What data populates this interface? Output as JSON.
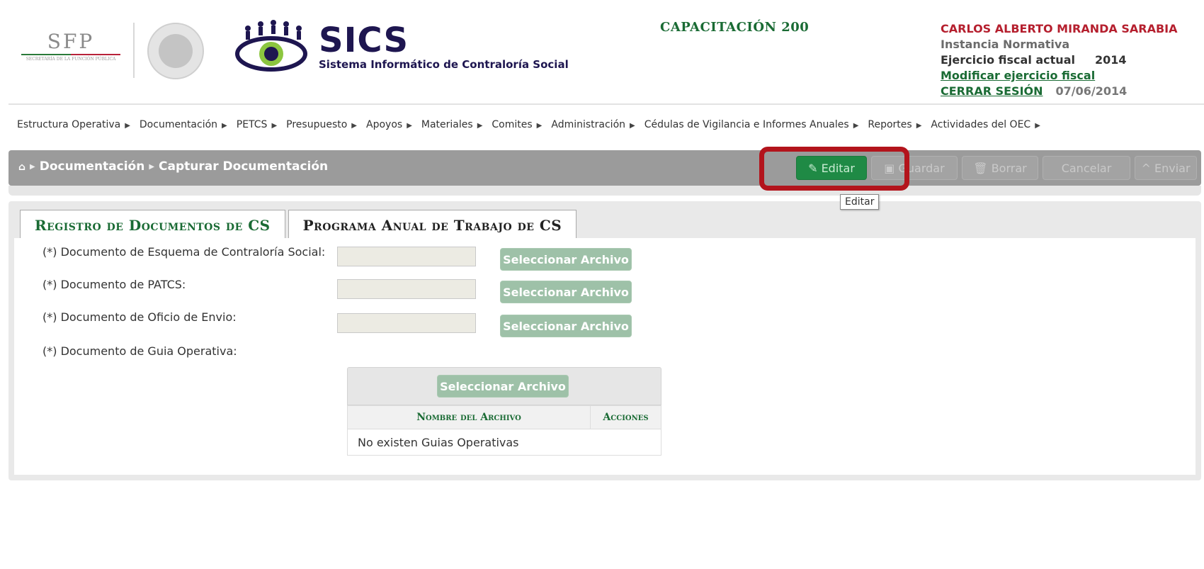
{
  "header": {
    "sfp_logo": {
      "text": "SFP",
      "subtitle": "SECRETARÍA DE LA FUNCIÓN PÚBLICA"
    },
    "app_logo": {
      "title": "SICS",
      "subtitle": "Sistema Informático de Contraloría Social"
    },
    "environment": "CAPACITACIÓN 200",
    "user": {
      "name": "CARLOS ALBERTO MIRANDA SARABIA",
      "role": "Instancia Normativa",
      "fiscal_label": "Ejercicio fiscal actual",
      "fiscal_year": "2014",
      "modify_link": "Modificar ejercicio fiscal",
      "logout_link": "CERRAR SESIÓN",
      "date": "07/06/2014"
    }
  },
  "menu": [
    {
      "label": "Estructura Operativa"
    },
    {
      "label": "Documentación"
    },
    {
      "label": "PETCS"
    },
    {
      "label": "Presupuesto"
    },
    {
      "label": "Apoyos"
    },
    {
      "label": "Materiales"
    },
    {
      "label": "Comites"
    },
    {
      "label": "Administración"
    },
    {
      "label": "Cédulas de Vigilancia e Informes Anuales"
    },
    {
      "label": "Reportes"
    },
    {
      "label": "Actividades del OEC"
    }
  ],
  "breadcrumb": {
    "level1": "Documentación",
    "level2": "Capturar Documentación"
  },
  "toolbar": {
    "edit": "Editar",
    "save": "Guardar",
    "delete": "Borrar",
    "cancel": "Cancelar",
    "send": "Enviar",
    "tooltip": "Editar"
  },
  "tabs": [
    {
      "label": "Registro de Documentos de CS",
      "active": true
    },
    {
      "label": "Programa Anual de Trabajo de CS",
      "active": false
    }
  ],
  "form": {
    "fields": [
      {
        "label": "(*) Documento de Esquema de Contraloría Social:",
        "button": "Seleccionar Archivo"
      },
      {
        "label": "(*) Documento de PATCS:",
        "button": "Seleccionar Archivo"
      },
      {
        "label": "(*) Documento de Oficio de Envio:",
        "button": "Seleccionar Archivo"
      },
      {
        "label": "(*) Documento de Guia Operativa:",
        "button": "Seleccionar Archivo"
      }
    ],
    "guide_table": {
      "headers": [
        "Nombre del Archivo",
        "Acciones"
      ],
      "empty_message": "No existen Guias Operativas"
    }
  },
  "colors": {
    "brand_green": "#1a6b34",
    "user_red": "#b51f2e",
    "highlight": "#b3141c",
    "toolbar_gray": "#9b9b9b"
  }
}
